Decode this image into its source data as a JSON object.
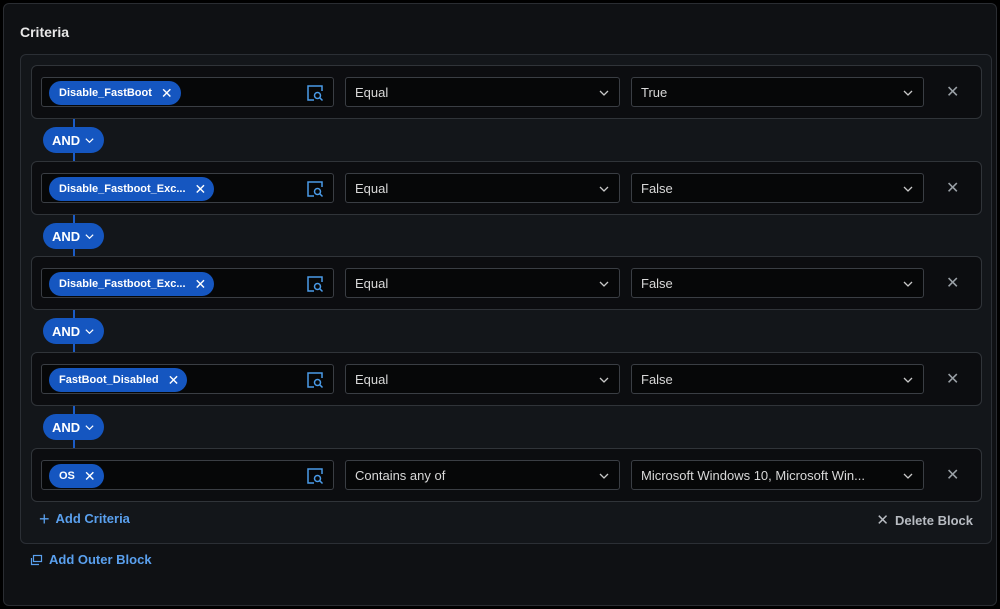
{
  "section_title": "Criteria",
  "criteria": [
    {
      "field": "Disable_FastBoot",
      "operator": "Equal",
      "value": "True"
    },
    {
      "field": "Disable_Fastboot_Exc...",
      "operator": "Equal",
      "value": "False"
    },
    {
      "field": "Disable_Fastboot_Exc...",
      "operator": "Equal",
      "value": "False"
    },
    {
      "field": "FastBoot_Disabled",
      "operator": "Equal",
      "value": "False"
    },
    {
      "field": "OS",
      "operator": "Contains any of",
      "value": "Microsoft Windows 10, Microsoft Win..."
    }
  ],
  "connectors": [
    "AND",
    "AND",
    "AND",
    "AND"
  ],
  "actions": {
    "add_criteria": "Add Criteria",
    "delete_block": "Delete Block",
    "add_outer_block": "Add Outer Block"
  },
  "colors": {
    "accent": "#1556c0",
    "link": "#5aa0ee",
    "background": "#0f1114"
  }
}
